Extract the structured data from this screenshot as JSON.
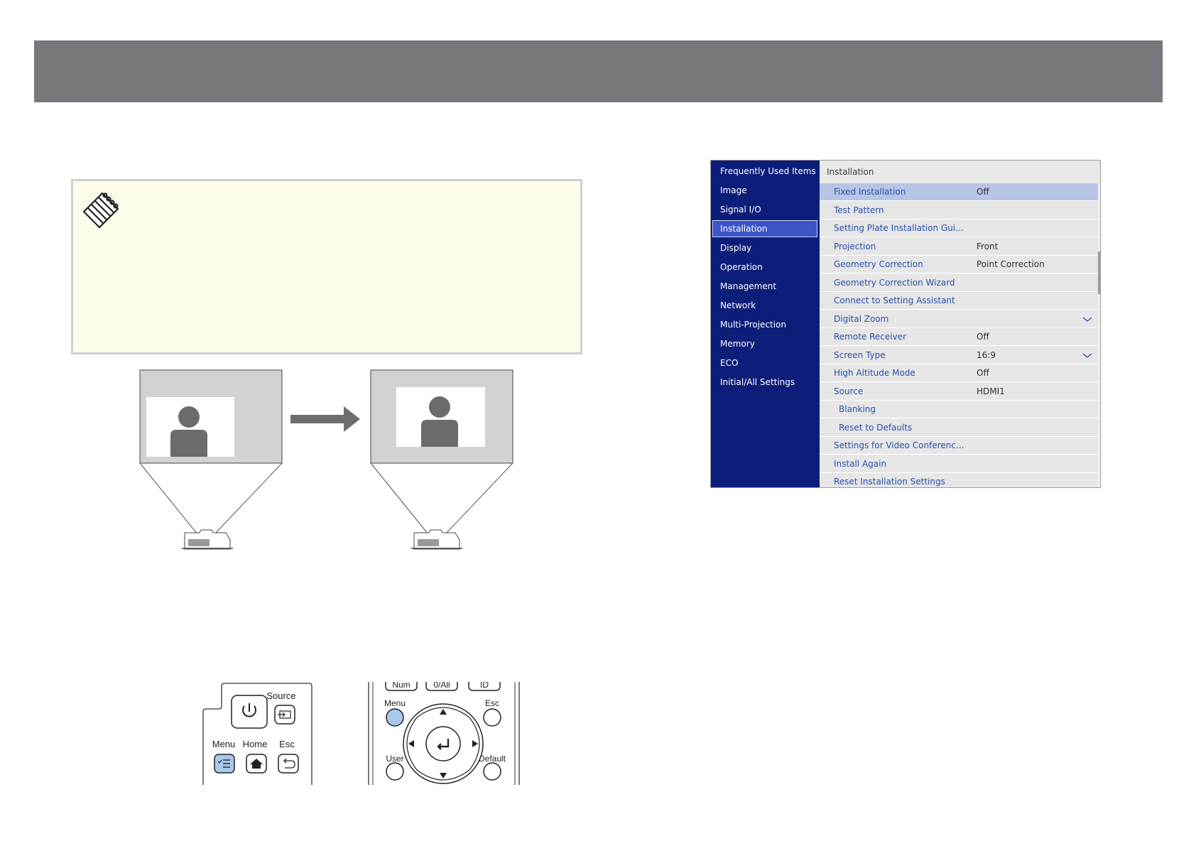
{
  "menu": {
    "sidebar": [
      {
        "label": "Frequently Used Items",
        "active": false
      },
      {
        "label": "Image",
        "active": false
      },
      {
        "label": "Signal I/O",
        "active": false
      },
      {
        "label": "Installation",
        "active": true
      },
      {
        "label": "Display",
        "active": false
      },
      {
        "label": "Operation",
        "active": false
      },
      {
        "label": "Management",
        "active": false
      },
      {
        "label": "Network",
        "active": false
      },
      {
        "label": "Multi-Projection",
        "active": false
      },
      {
        "label": "Memory",
        "active": false
      },
      {
        "label": "ECO",
        "active": false
      },
      {
        "label": "Initial/All Settings",
        "active": false
      }
    ],
    "title": "Installation",
    "rows": [
      {
        "label": "Fixed Installation",
        "value": "Off",
        "selected": true
      },
      {
        "label": "Test Pattern",
        "value": ""
      },
      {
        "label": "Setting Plate Installation Gui...",
        "value": ""
      },
      {
        "label": "Projection",
        "value": "Front"
      },
      {
        "label": "Geometry Correction",
        "value": "Point Correction"
      },
      {
        "label": "Geometry Correction Wizard",
        "value": ""
      },
      {
        "label": "Connect to Setting Assistant",
        "value": ""
      },
      {
        "label": "Digital Zoom",
        "value": "",
        "expand": true
      },
      {
        "label": "Remote Receiver",
        "value": "Off"
      },
      {
        "label": "Screen Type",
        "value": "16:9",
        "expand": true
      },
      {
        "label": "High Altitude Mode",
        "value": "Off"
      },
      {
        "label": "Source",
        "value": "HDMI1"
      },
      {
        "label": "Blanking",
        "value": "",
        "indent": true
      },
      {
        "label": "Reset to Defaults",
        "value": "",
        "indent": true
      },
      {
        "label": "Settings for Video Conferenc...",
        "value": ""
      },
      {
        "label": "Install Again",
        "value": ""
      },
      {
        "label": "Reset Installation Settings",
        "value": ""
      }
    ]
  },
  "remote_panel": {
    "source": "Source",
    "menu": "Menu",
    "home": "Home",
    "esc": "Esc"
  },
  "remote_control": {
    "num": "Num",
    "all": "0/All",
    "id": "ID",
    "menu": "Menu",
    "esc": "Esc",
    "user": "User",
    "default": "Default"
  },
  "colors": {
    "header": "#79777c",
    "note_bg": "#fdfcea",
    "menu_sidebar": "#0d1e7a",
    "menu_active": "#3d55c6",
    "menu_selected_row": "#b7c4e6",
    "menu_label": "#2a4fa8",
    "menu_button_highlight": "#a9c8ee"
  }
}
